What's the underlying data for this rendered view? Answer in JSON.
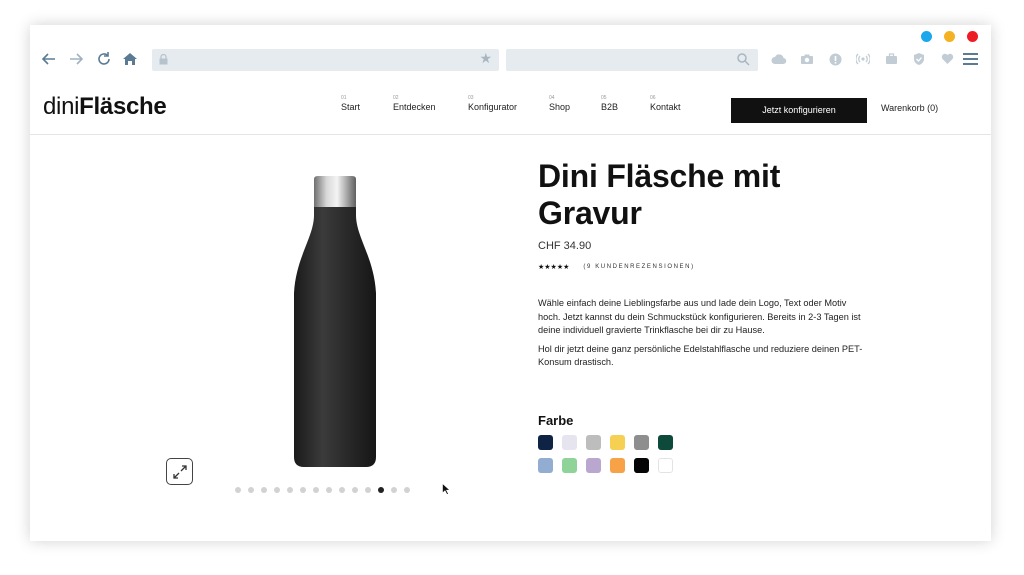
{
  "window": {
    "dots": [
      "#1aa7ec",
      "#f4b223",
      "#ee1c25"
    ]
  },
  "browser": {
    "nav_icons": [
      "back-arrow-icon",
      "forward-arrow-icon",
      "reload-icon",
      "home-icon"
    ],
    "url_value": "",
    "search_value": "",
    "toolbar_icons": [
      "cloud-download-icon",
      "camera-icon",
      "alert-icon",
      "broadcast-icon",
      "briefcase-icon",
      "shield-icon",
      "heart-icon"
    ]
  },
  "site": {
    "logo_thin": "dini",
    "logo_bold": "Fläsche",
    "menu": [
      {
        "num": "01",
        "label": "Start"
      },
      {
        "num": "02",
        "label": "Entdecken"
      },
      {
        "num": "03",
        "label": "Konfigurator"
      },
      {
        "num": "04",
        "label": "Shop"
      },
      {
        "num": "05",
        "label": "B2B"
      },
      {
        "num": "06",
        "label": "Kontakt"
      }
    ],
    "cta_label": "Jetzt konfigurieren",
    "cart_label": "Warenkorb (0)"
  },
  "product": {
    "title": "Dini Fläsche mit Gravur",
    "price": "CHF 34.90",
    "stars": "★★★★★",
    "reviews": "(9 KUNDENREZENSIONEN)",
    "desc_1": "Wähle einfach deine Lieblingsfarbe aus und lade dein Logo, Text oder Motiv hoch. Jetzt kannst du dein Schmuckstück konfigurieren. Bereits in 2-3 Tagen ist deine individuell gravierte Trinkflasche bei dir zu Hause.",
    "desc_2": "Hol dir jetzt deine ganz persönliche Edelstahlflasche und reduziere deinen PET-Konsum drastisch.",
    "color_heading": "Farbe",
    "colors": [
      "#0f2444",
      "#e6e4ef",
      "#bdbdbd",
      "#f6d052",
      "#8e8e8e",
      "#0d4a3c",
      "#92acd2",
      "#8fd399",
      "#b9a7cf",
      "#f8a248",
      "#050505",
      "#ffffff"
    ],
    "carousel_count": 14,
    "carousel_active": 11
  }
}
